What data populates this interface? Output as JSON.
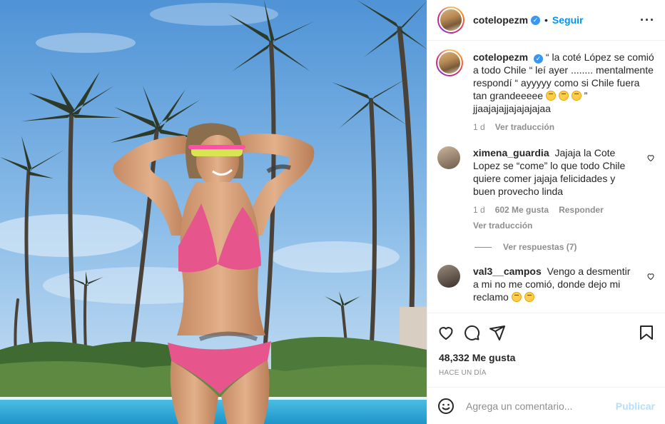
{
  "header": {
    "username": "cotelopezm",
    "verified": true,
    "separator": "•",
    "follow_label": "Seguir",
    "more_icon": "more-horizontal-icon"
  },
  "caption": {
    "username": "cotelopezm",
    "text": "“ la coté López se comió a todo Chile “ leí ayer ........ mentalmente respondí “ ayyyyy como si Chile fuera tan grandeeeee",
    "text_end": "” jjaajajajjajajajajaa",
    "time": "1 d",
    "translate_label": "Ver traducción"
  },
  "comments": [
    {
      "username": "ximena_guardia",
      "text": "Jajaja la Cote Lopez se “come” lo que todo Chile quiere comer jajaja felicidades y buen provecho linda",
      "time": "1 d",
      "likes": "602 Me gusta",
      "reply_label": "Responder",
      "translate_label": "Ver traducción",
      "view_replies_label": "Ver respuestas (7)"
    },
    {
      "username": "val3__campos",
      "text": "Vengo a desmentir a mi no me comió, donde dejo mi reclamo"
    }
  ],
  "actions": {
    "like_icon": "heart-icon",
    "comment_icon": "comment-icon",
    "share_icon": "share-icon",
    "save_icon": "bookmark-icon"
  },
  "likes_count": "48,332 Me gusta",
  "posted_ago": "HACE UN DÍA",
  "composer": {
    "placeholder": "Agrega un comentario...",
    "publish_label": "Publicar",
    "emoji_icon": "smile-icon"
  },
  "colors": {
    "link_blue": "#0095f6",
    "verified_blue": "#3897f0",
    "muted": "#8e8e8e",
    "publish_disabled": "#b2dffc"
  }
}
